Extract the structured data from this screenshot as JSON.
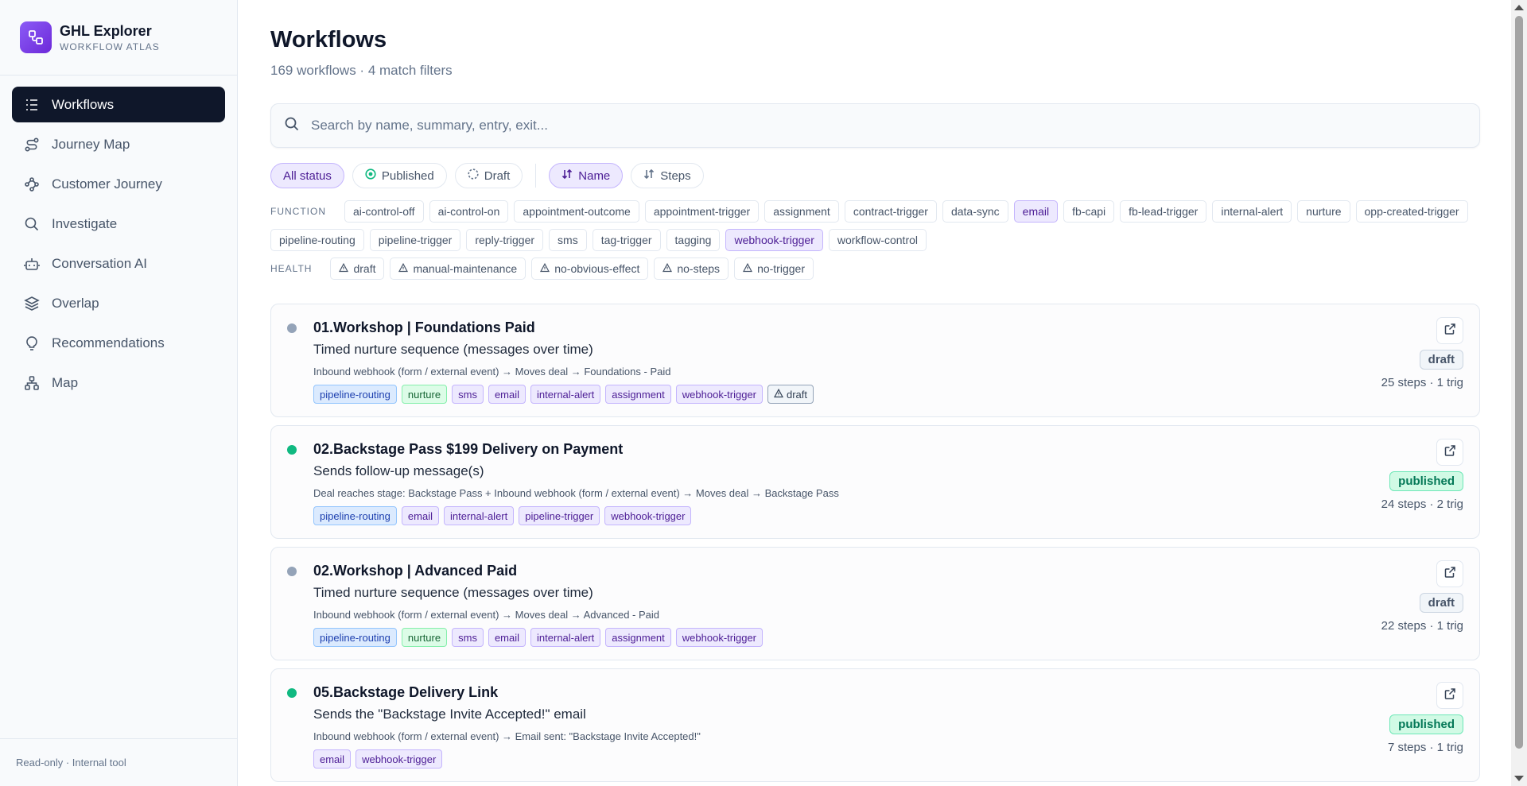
{
  "brand": {
    "name": "GHL Explorer",
    "subtitle": "WORKFLOW ATLAS",
    "icon": "workflow-logo-icon",
    "color": "#7c3aed"
  },
  "sidebar": {
    "items": [
      {
        "label": "Workflows",
        "icon": "list-icon",
        "active": true
      },
      {
        "label": "Journey Map",
        "icon": "route-icon"
      },
      {
        "label": "Customer Journey",
        "icon": "waypoints-icon"
      },
      {
        "label": "Investigate",
        "icon": "search-icon"
      },
      {
        "label": "Conversation AI",
        "icon": "bot-icon"
      },
      {
        "label": "Overlap",
        "icon": "layers-icon"
      },
      {
        "label": "Recommendations",
        "icon": "lightbulb-icon"
      },
      {
        "label": "Map",
        "icon": "network-icon"
      }
    ],
    "footer": "Read-only · Internal tool"
  },
  "header": {
    "title": "Workflows",
    "subtitle": "169 workflows · 4 match filters"
  },
  "search": {
    "placeholder": "Search by name, summary, entry, exit..."
  },
  "filters": {
    "status": [
      "All status",
      "Published",
      "Draft"
    ],
    "sort": [
      "Name",
      "Steps"
    ],
    "function_label": "FUNCTION",
    "function_chips": [
      "ai-control-off",
      "ai-control-on",
      "appointment-outcome",
      "appointment-trigger",
      "assignment",
      "contract-trigger",
      "data-sync",
      "email",
      "fb-capi",
      "fb-lead-trigger",
      "internal-alert",
      "nurture",
      "opp-created-trigger",
      "pipeline-routing",
      "pipeline-trigger",
      "reply-trigger",
      "sms",
      "tag-trigger",
      "tagging",
      "webhook-trigger",
      "workflow-control"
    ],
    "function_active": [
      "email",
      "webhook-trigger"
    ],
    "health_label": "HEALTH",
    "health_chips": [
      "draft",
      "manual-maintenance",
      "no-obvious-effect",
      "no-steps",
      "no-trigger"
    ]
  },
  "workflows": [
    {
      "title": "01.Workshop | Foundations Paid",
      "summary": "Timed nurture sequence (messages over time)",
      "flow": "Inbound webhook (form / external event) → Moves deal → Foundations - Paid",
      "tags": [
        "pipeline-routing",
        "nurture",
        "sms",
        "email",
        "internal-alert",
        "assignment",
        "webhook-trigger",
        "draft"
      ],
      "status": "draft",
      "meta": "25 steps · 1 trig"
    },
    {
      "title": "02.Backstage Pass $199 Delivery on Payment",
      "summary": "Sends follow-up message(s)",
      "flow": "Deal reaches stage: Backstage Pass + Inbound webhook (form / external event) → Moves deal → Backstage Pass",
      "tags": [
        "pipeline-routing",
        "email",
        "internal-alert",
        "pipeline-trigger",
        "webhook-trigger"
      ],
      "status": "published",
      "meta": "24 steps · 2 trig"
    },
    {
      "title": "02.Workshop | Advanced Paid",
      "summary": "Timed nurture sequence (messages over time)",
      "flow": "Inbound webhook (form / external event) → Moves deal → Advanced - Paid",
      "tags": [
        "pipeline-routing",
        "nurture",
        "sms",
        "email",
        "internal-alert",
        "assignment",
        "webhook-trigger"
      ],
      "status": "draft",
      "meta": "22 steps · 1 trig"
    },
    {
      "title": "05.Backstage Delivery Link",
      "summary": "Sends the \"Backstage Invite Accepted!\" email",
      "flow": "Inbound webhook (form / external event) → Email sent: \"Backstage Invite Accepted!\"",
      "tags": [
        "email",
        "webhook-trigger"
      ],
      "status": "published",
      "meta": "7 steps · 1 trig"
    }
  ],
  "colors": {
    "draft_dot": "#94a3b8",
    "published_dot": "#10b981",
    "accent": "#7c3aed"
  }
}
